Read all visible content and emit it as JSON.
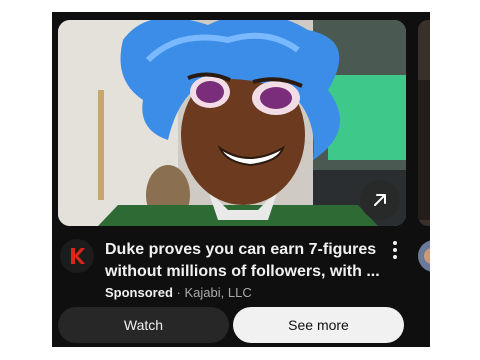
{
  "ad": {
    "title": "Duke proves you can earn 7-figures without millions of followers, with ...",
    "sponsored_label": "Sponsored",
    "separator": "·",
    "advertiser": "Kajabi, LLC",
    "channel_logo_letter": "k",
    "brand_color": "#e0241b",
    "buttons": {
      "watch": "Watch",
      "see_more": "See more"
    },
    "icons": {
      "open": "arrow-up-right-icon",
      "more": "more-vert-icon"
    }
  }
}
